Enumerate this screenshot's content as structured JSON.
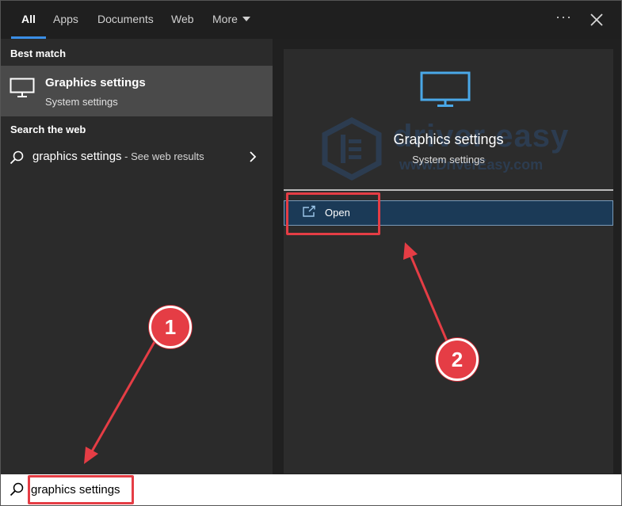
{
  "tabs": [
    {
      "label": "All",
      "active": true
    },
    {
      "label": "Apps"
    },
    {
      "label": "Documents"
    },
    {
      "label": "Web"
    },
    {
      "label": "More"
    }
  ],
  "header": {
    "more_icon": "ellipsis-icon",
    "close_icon": "close-icon"
  },
  "left": {
    "best_match_heading": "Best match",
    "best_match": {
      "title": "Graphics settings",
      "subtitle": "System settings",
      "icon": "monitor-icon"
    },
    "web_heading": "Search the web",
    "web_result": {
      "query": "graphics settings",
      "suffix": " - See web results",
      "icon": "search-icon"
    }
  },
  "preview": {
    "title": "Graphics settings",
    "subtitle": "System settings",
    "icon": "monitor-icon",
    "actions": [
      {
        "label": "Open",
        "icon": "open-window-icon"
      }
    ],
    "watermark_text": "driver easy",
    "watermark_url": "www.DriverEasy.com"
  },
  "search": {
    "value": "graphics settings",
    "icon": "search-icon"
  },
  "annotations": {
    "step1": "1",
    "step2": "2",
    "color": "#e53d45"
  },
  "colors": {
    "accent": "#3a8ee6",
    "selected": "#4a4a4a",
    "action_bg": "#1b3a57"
  }
}
